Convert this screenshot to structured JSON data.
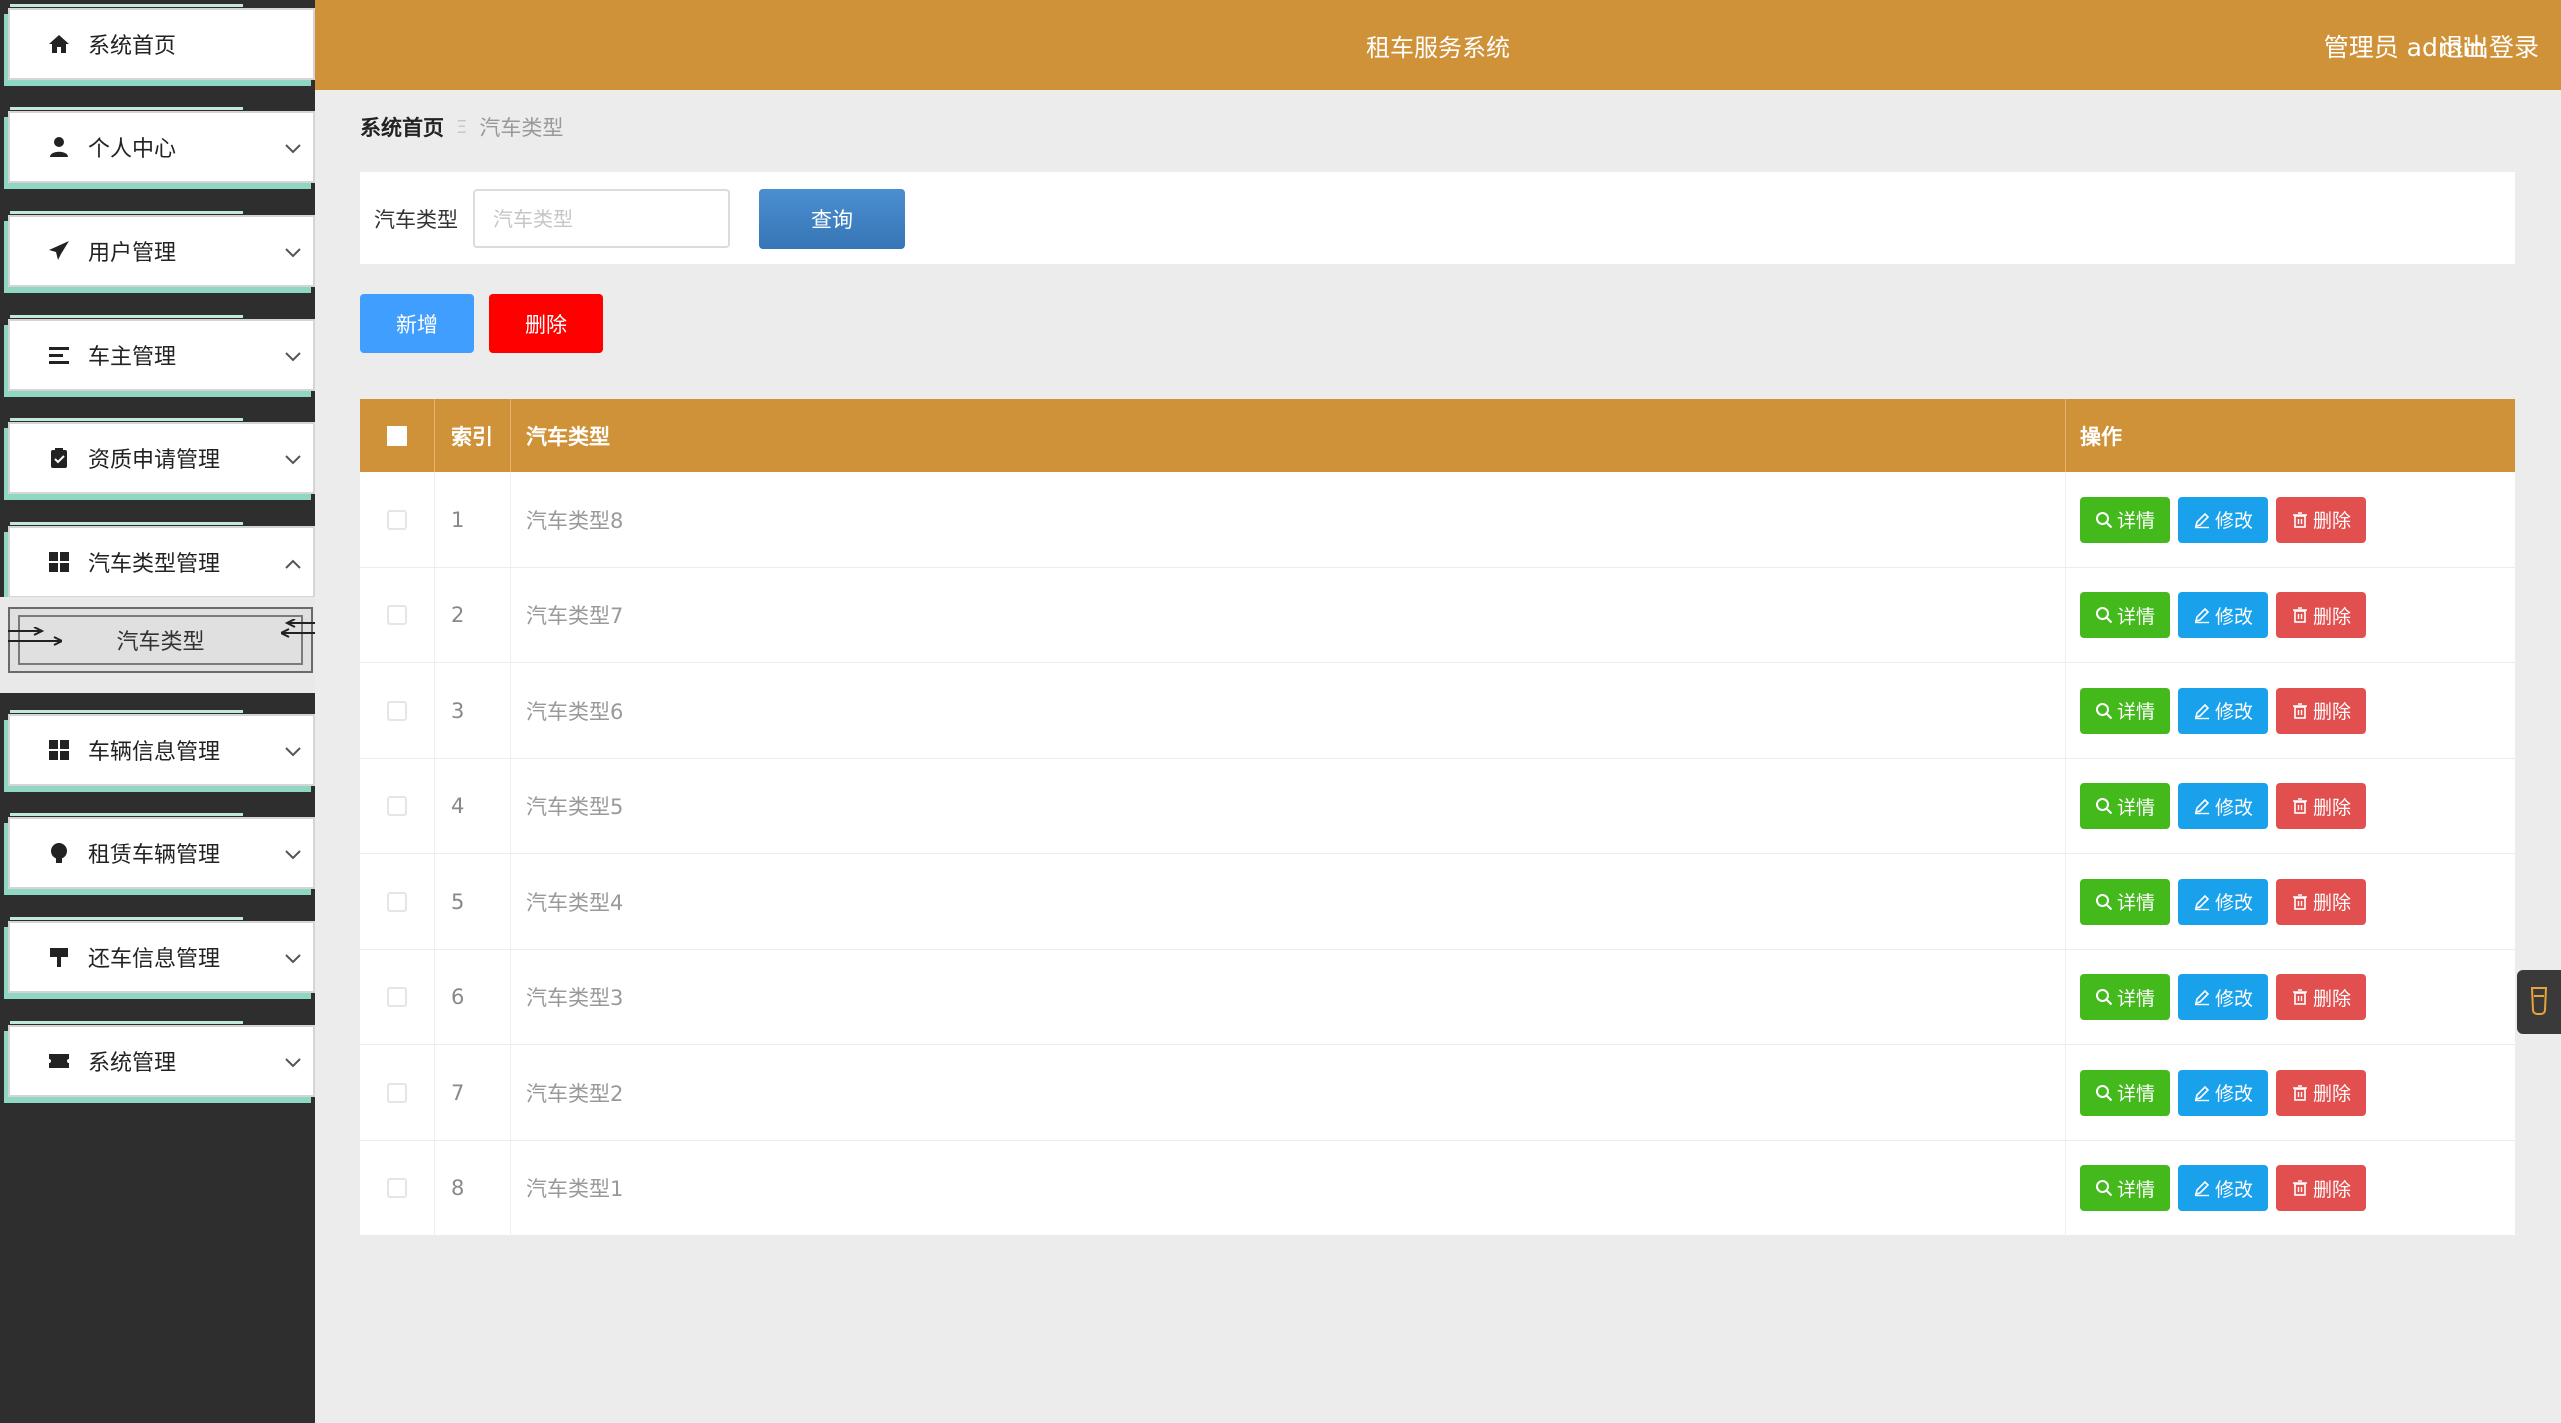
{
  "header": {
    "title": "租车服务系统",
    "user": "管理员 admin",
    "logout": "退出登录"
  },
  "sidebar": {
    "items": [
      {
        "label": "系统首页",
        "icon": "home-icon"
      },
      {
        "label": "个人中心",
        "icon": "user-icon"
      },
      {
        "label": "用户管理",
        "icon": "send-icon"
      },
      {
        "label": "车主管理",
        "icon": "list-icon"
      },
      {
        "label": "资质申请管理",
        "icon": "clipboard-icon"
      },
      {
        "label": "汽车类型管理",
        "icon": "grid-icon"
      },
      {
        "label": "车辆信息管理",
        "icon": "grid-icon"
      },
      {
        "label": "租赁车辆管理",
        "icon": "bulb-icon"
      },
      {
        "label": "还车信息管理",
        "icon": "sign-icon"
      },
      {
        "label": "系统管理",
        "icon": "ticket-icon"
      }
    ],
    "submenu": {
      "label": "汽车类型"
    }
  },
  "breadcrumb": {
    "home": "系统首页",
    "separator": "Ξ",
    "current": "汽车类型"
  },
  "search": {
    "label": "汽车类型",
    "placeholder": "汽车类型",
    "value": "",
    "query_label": "查询"
  },
  "actions": {
    "add_label": "新增",
    "delete_label": "删除"
  },
  "table": {
    "columns": [
      "索引",
      "汽车类型",
      "操作"
    ],
    "op_labels": {
      "detail": "详情",
      "edit": "修改",
      "delete": "删除"
    },
    "rows": [
      {
        "index": "1",
        "type": "汽车类型8"
      },
      {
        "index": "2",
        "type": "汽车类型7"
      },
      {
        "index": "3",
        "type": "汽车类型6"
      },
      {
        "index": "4",
        "type": "汽车类型5"
      },
      {
        "index": "5",
        "type": "汽车类型4"
      },
      {
        "index": "6",
        "type": "汽车类型3"
      },
      {
        "index": "7",
        "type": "汽车类型2"
      },
      {
        "index": "8",
        "type": "汽车类型1"
      }
    ]
  },
  "colors": {
    "header": "#cf9238",
    "sidebar": "#2e2e2e",
    "detail": "#44b91c",
    "edit": "#1aa1eb",
    "delete": "#e24f4f",
    "add": "#409eff",
    "danger": "#ff0000"
  }
}
